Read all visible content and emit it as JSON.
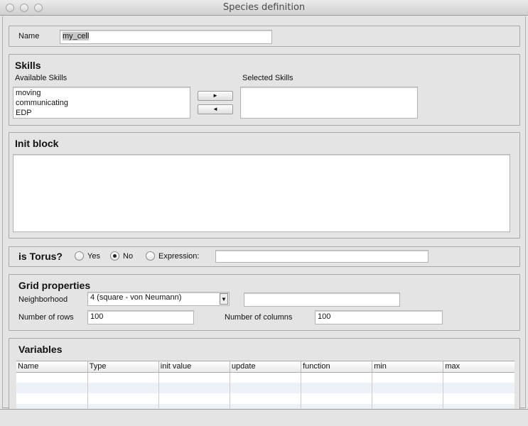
{
  "window": {
    "title": "Species definition"
  },
  "name": {
    "label": "Name",
    "value": "my_cell"
  },
  "skills": {
    "title": "Skills",
    "available_label": "Available Skills",
    "selected_label": "Selected Skills",
    "available": [
      "moving",
      "communicating",
      "EDP"
    ],
    "selected": [],
    "add_label": "►",
    "remove_label": "◄"
  },
  "init": {
    "title": "Init block",
    "value": ""
  },
  "torus": {
    "title": "is Torus?",
    "options": [
      "Yes",
      "No",
      "Expression:"
    ],
    "selected": "No",
    "expression": ""
  },
  "grid": {
    "title": "Grid properties",
    "neighborhood_label": "Neighborhood",
    "neighborhood_value": "4 (square - von Neumann)",
    "neighborhood_extra": "",
    "rows_label": "Number of rows",
    "rows": "100",
    "cols_label": "Number of columns",
    "cols": "100"
  },
  "variables": {
    "title": "Variables",
    "columns": [
      "Name",
      "Type",
      "init value",
      "update",
      "function",
      "min",
      "max"
    ],
    "rows": []
  }
}
